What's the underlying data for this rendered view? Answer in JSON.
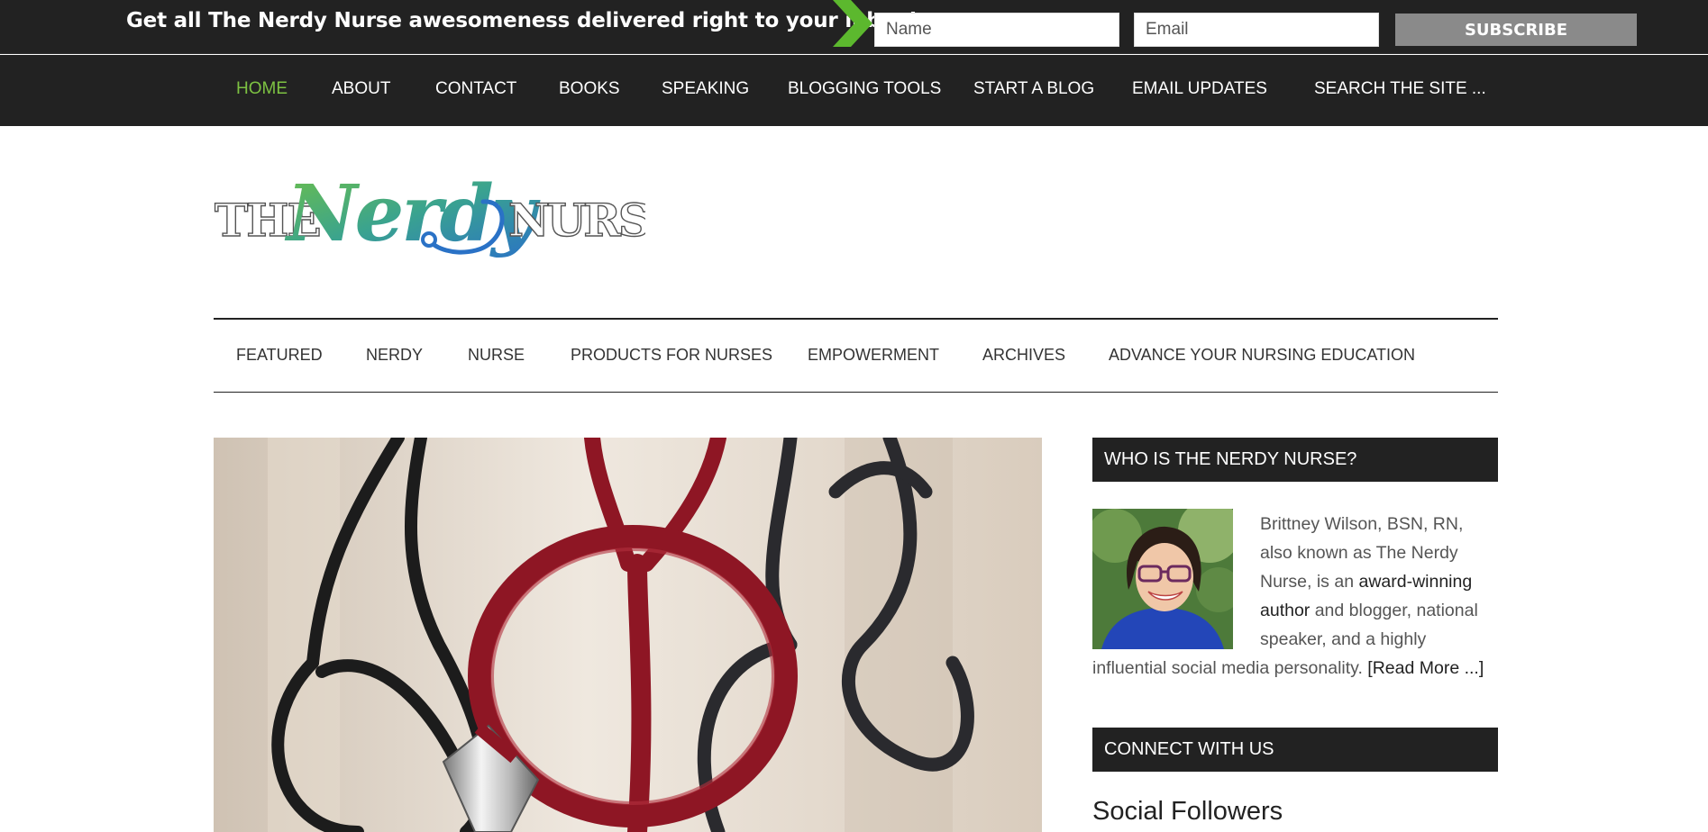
{
  "topbar": {
    "promo_text": "Get all The Nerdy Nurse awesomeness delivered right to your inbox!",
    "name_placeholder": "Name",
    "email_placeholder": "Email",
    "subscribe_label": "SUBSCRIBE",
    "arrow_color": "#5cb82e"
  },
  "main_nav": {
    "items": [
      {
        "label": "HOME",
        "active": true
      },
      {
        "label": "ABOUT"
      },
      {
        "label": "CONTACT"
      },
      {
        "label": "BOOKS"
      },
      {
        "label": "SPEAKING"
      },
      {
        "label": "BLOGGING TOOLS"
      },
      {
        "label": "START A BLOG"
      },
      {
        "label": "EMAIL UPDATES"
      }
    ],
    "search_placeholder": "SEARCH THE SITE ...",
    "active_color": "#7dc242"
  },
  "logo": {
    "text_left": "THE",
    "text_script": "Nerdy",
    "text_right": "NURSE"
  },
  "category_nav": {
    "items": [
      {
        "label": "FEATURED"
      },
      {
        "label": "NERDY"
      },
      {
        "label": "NURSE"
      },
      {
        "label": "PRODUCTS FOR NURSES"
      },
      {
        "label": "EMPOWERMENT"
      },
      {
        "label": "ARCHIVES"
      },
      {
        "label": "ADVANCE YOUR NURSING EDUCATION"
      }
    ]
  },
  "sidebar": {
    "about_title": "WHO IS THE NERDY NURSE?",
    "bio_part1": "Brittney Wilson, BSN, RN, also known as The Nerdy Nurse, is an ",
    "bio_link": "award-winning author",
    "bio_part2": " and blogger, national speaker, and a highly influential social media personality. ",
    "read_more": "[Read More ...]",
    "connect_title": "CONNECT WITH US",
    "social_title": "Social Followers"
  }
}
